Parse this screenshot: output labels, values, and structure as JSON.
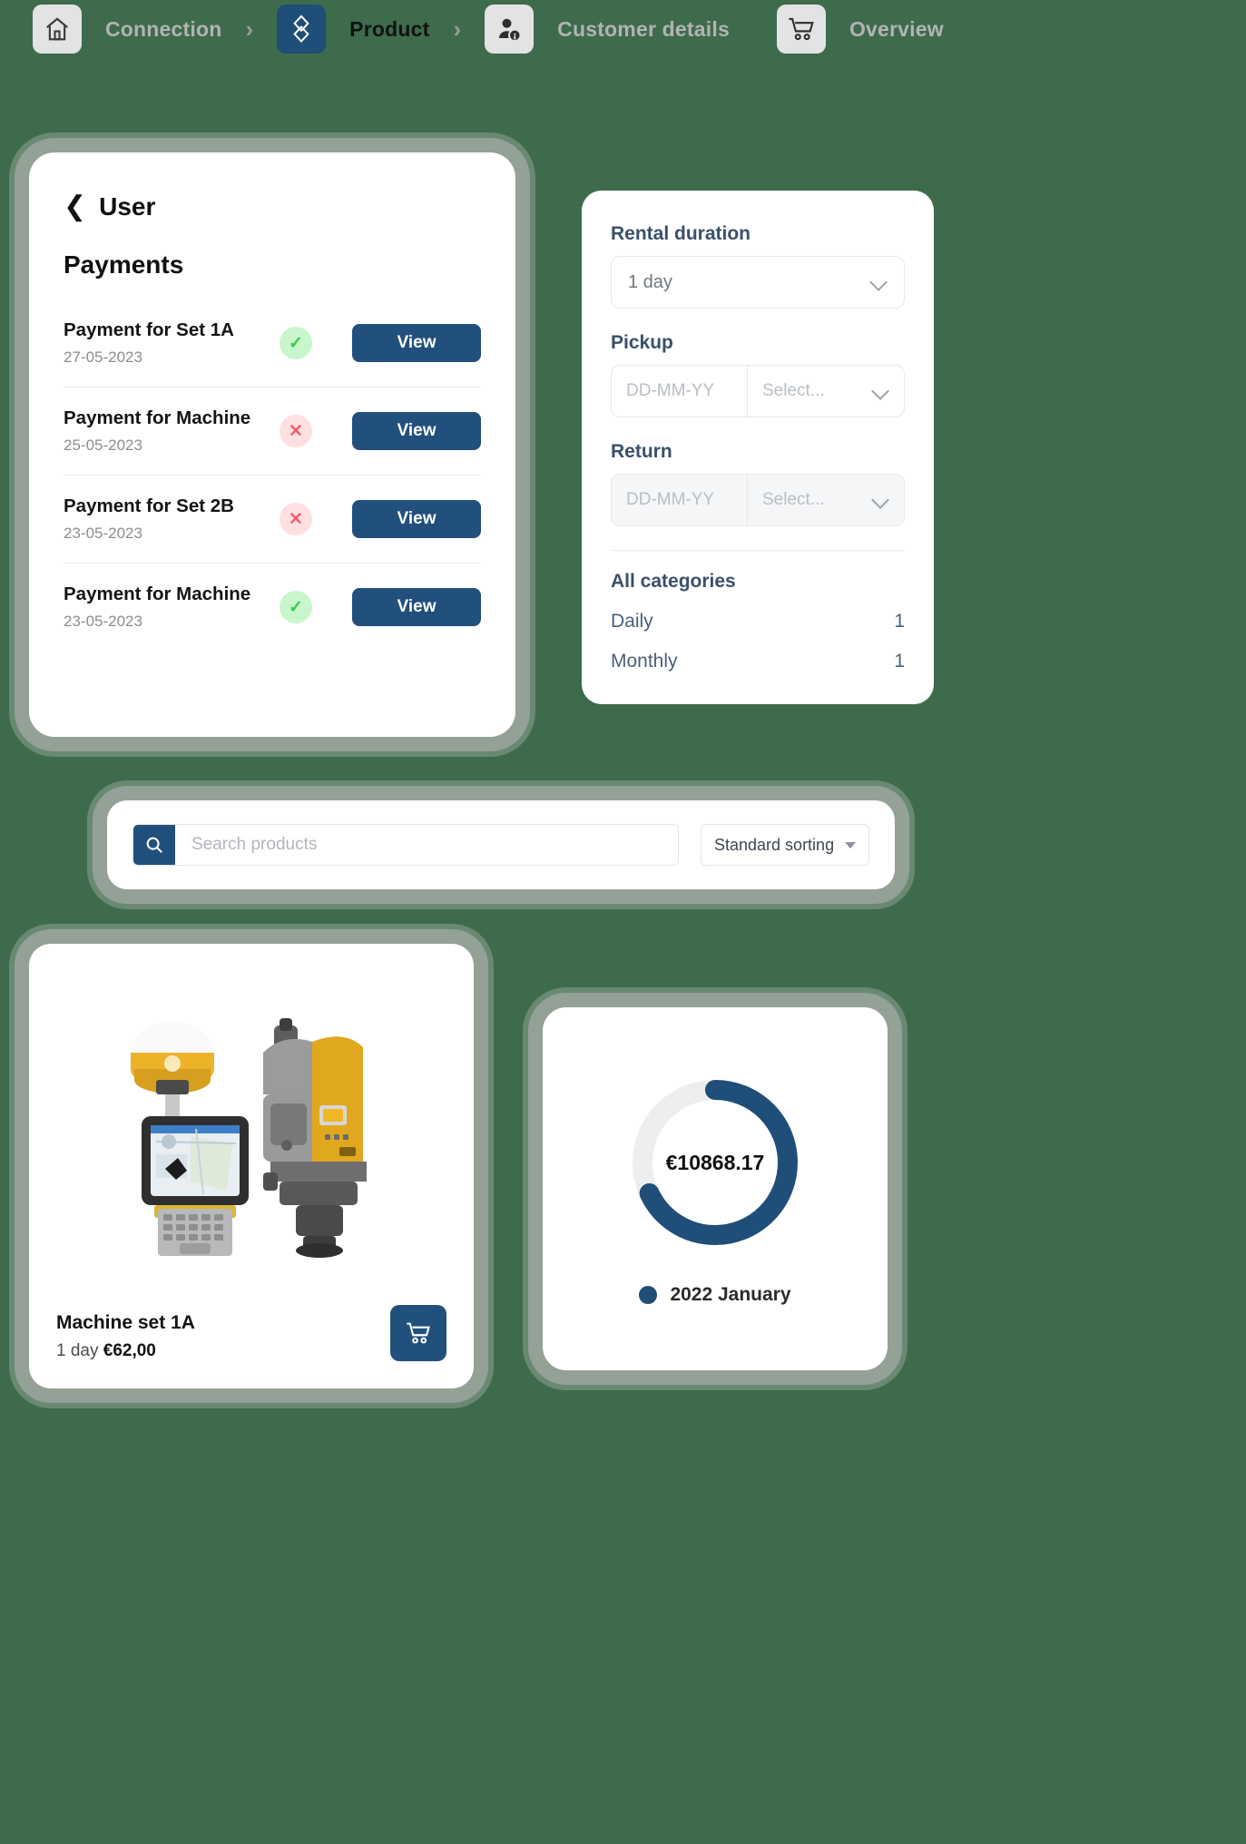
{
  "breadcrumb": {
    "steps": [
      {
        "icon": "home-icon",
        "label": "Connection",
        "active": false
      },
      {
        "icon": "package-icon",
        "label": "Product",
        "active": true
      },
      {
        "icon": "customer-icon",
        "label": "Customer details",
        "active": false
      },
      {
        "icon": "cart-icon",
        "label": "Overview",
        "active": false
      }
    ],
    "separator": "›"
  },
  "payments": {
    "back_label": "User",
    "back_icon": "chevron-left-icon",
    "title": "Payments",
    "rows": [
      {
        "name": "Payment for Set 1A",
        "date": "27-05-2023",
        "status": "ok",
        "status_glyph": "✓",
        "action": "View"
      },
      {
        "name": "Payment for Machine",
        "date": "25-05-2023",
        "status": "bad",
        "status_glyph": "✕",
        "action": "View"
      },
      {
        "name": "Payment for Set 2B",
        "date": "23-05-2023",
        "status": "bad",
        "status_glyph": "✕",
        "action": "View"
      },
      {
        "name": "Payment for Machine",
        "date": "23-05-2023",
        "status": "ok",
        "status_glyph": "✓",
        "action": "View"
      }
    ]
  },
  "filters": {
    "rental_duration_label": "Rental duration",
    "rental_duration_value": "1 day",
    "pickup_label": "Pickup",
    "pickup_date_placeholder": "DD-MM-YY",
    "pickup_select_placeholder": "Select...",
    "return_label": "Return",
    "return_date_placeholder": "DD-MM-YY",
    "return_select_placeholder": "Select...",
    "categories_title": "All categories",
    "categories": [
      {
        "label": "Daily",
        "count": "1"
      },
      {
        "label": "Monthly",
        "count": "1"
      }
    ]
  },
  "search": {
    "icon": "search-icon",
    "placeholder": "Search products",
    "value": "",
    "sort_value": "Standard sorting",
    "sort_icon": "caret-down-icon"
  },
  "product": {
    "image_alt": "surveying-equipment-photo",
    "name": "Machine set 1A",
    "duration": "1 day",
    "price": "€62,00",
    "cart_icon": "cart-icon"
  },
  "chart_data": {
    "type": "pie",
    "title": "",
    "center_label": "€10868.17",
    "categories": [
      "2022 January"
    ],
    "values": [
      68
    ],
    "colors": [
      "#1f4e79"
    ],
    "track_color": "#eceef0",
    "legend": [
      "2022 January"
    ],
    "legend_position": "bottom",
    "donut": true,
    "total": 10868.17,
    "currency": "€",
    "percent_filled": 68
  },
  "colors": {
    "background": "#3e6b4b",
    "accent": "#22507c",
    "accent_dark": "#1f4e79",
    "success": "#3ec552",
    "success_bg": "#c9f7cd",
    "error": "#f2606b",
    "error_bg": "#fde0e2",
    "label": "#3a506b",
    "card": "#ffffff"
  }
}
